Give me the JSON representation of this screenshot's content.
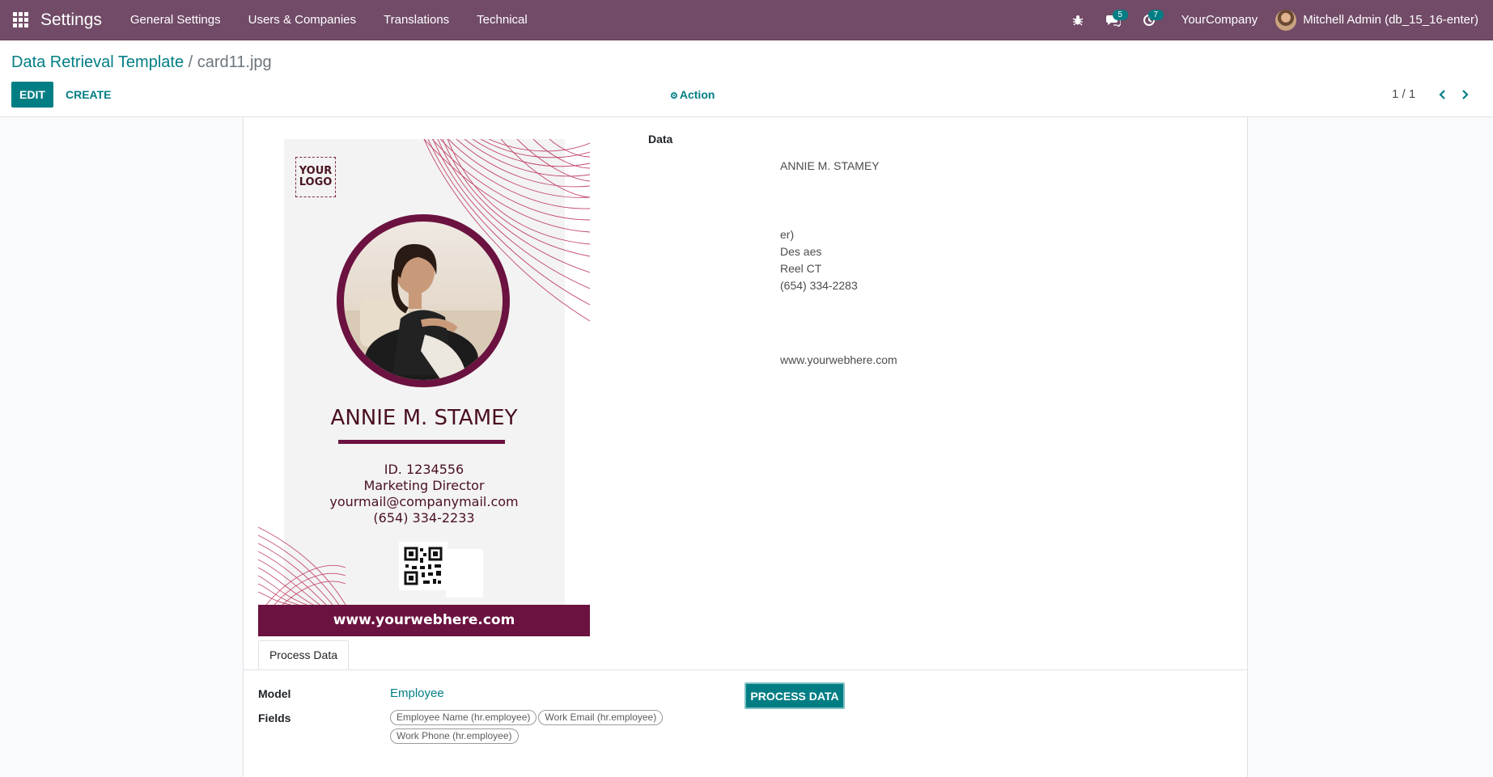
{
  "navbar": {
    "app_name": "Settings",
    "menu": [
      "General Settings",
      "Users & Companies",
      "Translations",
      "Technical"
    ],
    "messages_badge": "5",
    "activity_badge": "7",
    "company": "YourCompany",
    "user": "Mitchell Admin (db_15_16-enter)",
    "icons": [
      "apps-icon",
      "bug-icon",
      "chat-icon",
      "clock-icon"
    ],
    "color": "#714b67"
  },
  "breadcrumb": {
    "parent": "Data Retrieval Template",
    "separator": "/",
    "current": "card11.jpg"
  },
  "buttons": {
    "edit": "EDIT",
    "create": "CREATE",
    "action": "Action",
    "process": "PROCESS DATA"
  },
  "pager": {
    "value": "1 / 1"
  },
  "card": {
    "logo_line1": "YOUR",
    "logo_line2": "LOGO",
    "name": "ANNIE M. STAMEY",
    "id": "ID. 1234556",
    "title": "Marketing Director",
    "email": "yourmail@companymail.com",
    "phone": "(654) 334-2233",
    "website": "www.yourwebhere.com"
  },
  "data_section": {
    "label": "Data",
    "name": "ANNIE M. STAMEY",
    "line1": "er)",
    "line2": "Des aes",
    "line3": "Reel CT",
    "line4": "(654) 334-2283",
    "website": "www.yourwebhere.com"
  },
  "tab": {
    "label": "Process Data"
  },
  "process": {
    "model_label": "Model",
    "model_value": "Employee",
    "fields_label": "Fields",
    "fields": [
      "Employee Name (hr.employee)",
      "Work Email (hr.employee)",
      "Work Phone (hr.employee)"
    ]
  },
  "colors": {
    "accent": "#017e84",
    "card_maroon": "#6b1240"
  }
}
